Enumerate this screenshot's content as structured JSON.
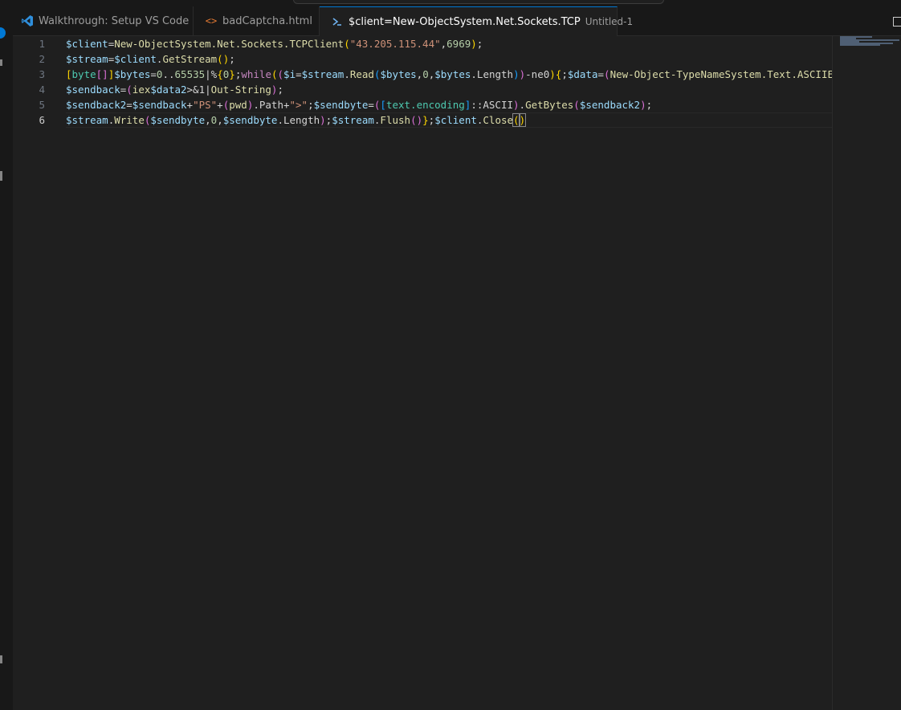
{
  "tabs": [
    {
      "label": "Walkthrough: Setup VS Code",
      "icon": "vscode-logo-icon",
      "active": false
    },
    {
      "label": "badCaptcha.html",
      "icon": "html-file-icon",
      "active": false
    },
    {
      "label": "$client=New-ObjectSystem.Net.Sockets.TCP",
      "description": "Untitled-1",
      "icon": "powershell-icon",
      "active": true,
      "dirty": true
    }
  ],
  "editor": {
    "line_numbers": [
      "1",
      "2",
      "3",
      "4",
      "5",
      "6"
    ],
    "active_line": "6"
  },
  "colors": {
    "accent": "#0078d4",
    "background": "#1f1f1f",
    "tab_bar": "#181818"
  }
}
